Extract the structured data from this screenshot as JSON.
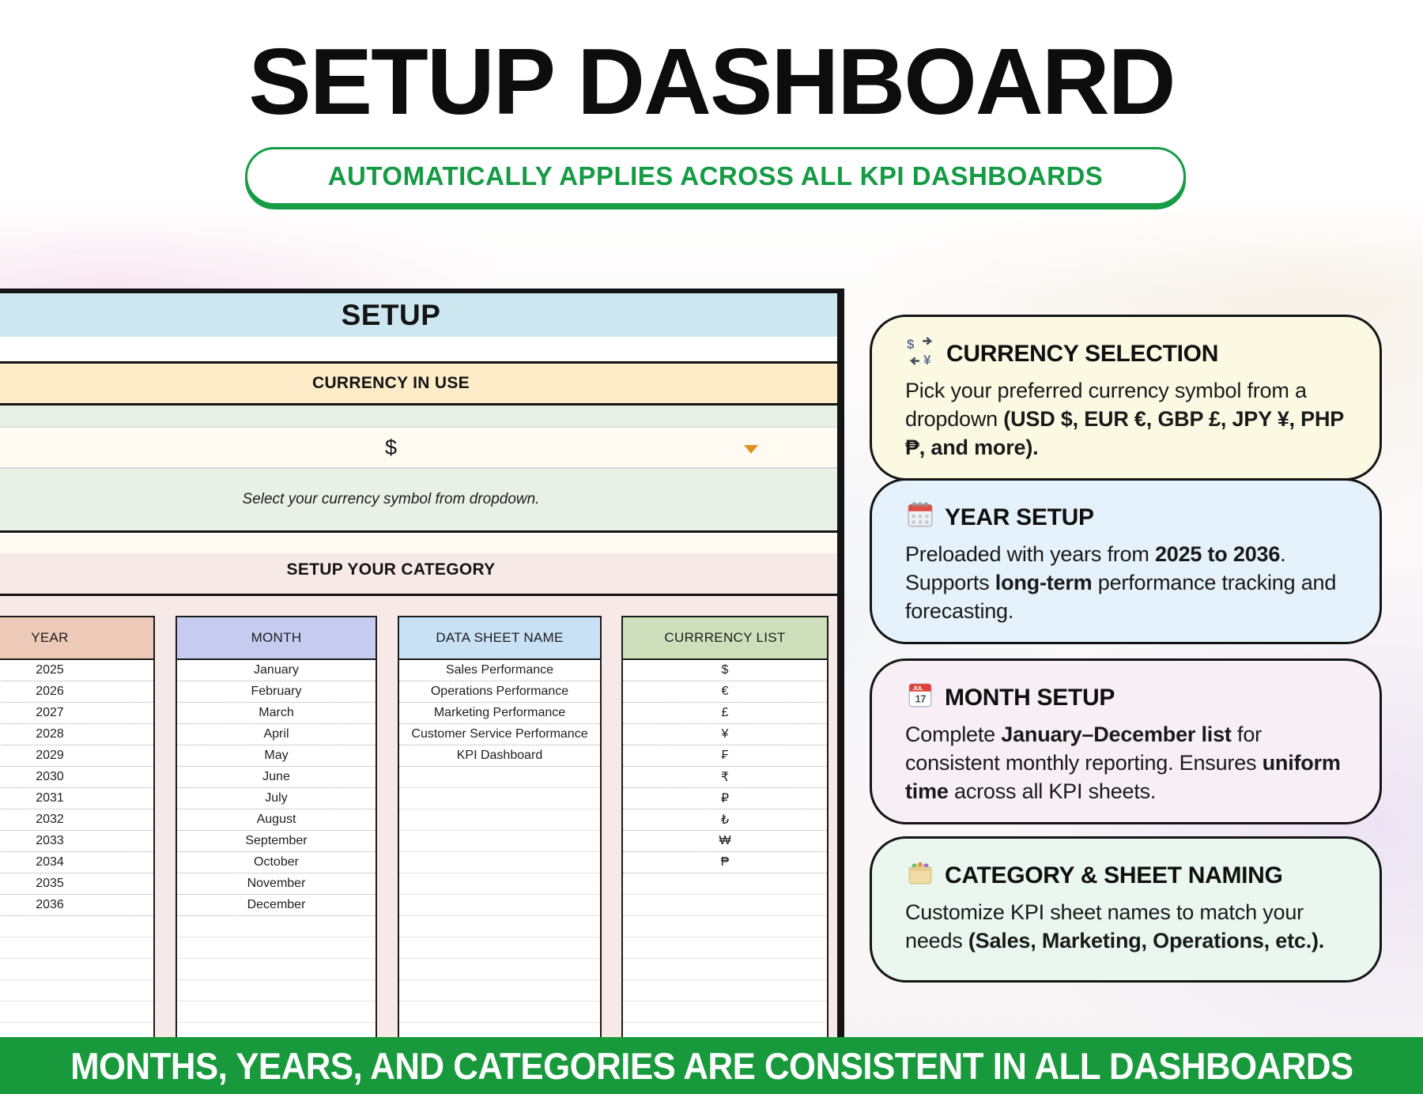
{
  "page": {
    "title": "SETUP DASHBOARD",
    "badge": "AUTOMATICALLY APPLIES ACROSS ALL KPI DASHBOARDS",
    "footer": "MONTHS, YEARS, AND CATEGORIES ARE CONSISTENT IN ALL DASHBOARDS"
  },
  "colors": {
    "accent_green": "#169c44",
    "banner_green": "#189a3c",
    "sheet_header_blue": "#cde7f0",
    "currency_band_yellow": "#fcedc8",
    "category_section_pink": "#f6e9e7",
    "dropdown_caret_orange": "#e0921f"
  },
  "sheet": {
    "title": "SETUP",
    "currency": {
      "header": "CURRENCY IN USE",
      "value": "$",
      "dropdown_icon": "chevron-down-icon",
      "helper": "Select your currency symbol from dropdown."
    },
    "category": {
      "header": "SETUP YOUR CATEGORY",
      "tables": [
        {
          "name": "year",
          "header": "YEAR",
          "header_color": "#edc9b8",
          "values": [
            "2025",
            "2026",
            "2027",
            "2028",
            "2029",
            "2030",
            "2031",
            "2032",
            "2033",
            "2034",
            "2035",
            "2036"
          ]
        },
        {
          "name": "month",
          "header": "MONTH",
          "header_color": "#c6ccf0",
          "values": [
            "January",
            "February",
            "March",
            "April",
            "May",
            "June",
            "July",
            "August",
            "September",
            "October",
            "November",
            "December"
          ]
        },
        {
          "name": "data-sheet-name",
          "header": "DATA SHEET NAME",
          "header_color": "#c9e1f5",
          "values": [
            "Sales Performance",
            "Operations Performance",
            "Marketing Performance",
            "Customer Service Performance",
            "KPI Dashboard"
          ]
        },
        {
          "name": "currency-list",
          "header": "CURRRENCY LIST",
          "header_color": "#cedfbc",
          "values": [
            "$",
            "€",
            "£",
            "¥",
            "₣",
            "₹",
            "₽",
            "₺",
            "₩",
            "₱"
          ]
        }
      ]
    }
  },
  "callouts": [
    {
      "icon": "currency-exchange-icon",
      "bg": "#fcf9e2",
      "title": "CURRENCY SELECTION",
      "body": [
        {
          "t": "Pick your preferred currency symbol from a dropdown "
        },
        {
          "t": "(USD $, EUR €, GBP £, JPY ¥, PHP ₱, and more).",
          "b": true
        }
      ]
    },
    {
      "icon": "spiral-calendar-icon",
      "bg": "#e5f2fb",
      "title": "YEAR SETUP",
      "body": [
        {
          "t": "Preloaded with years from "
        },
        {
          "t": "2025 to 2036",
          "b": true
        },
        {
          "t": ". Supports "
        },
        {
          "t": "long-term",
          "b": true
        },
        {
          "t": " performance tracking and forecasting."
        }
      ]
    },
    {
      "icon": "calendar-date-icon",
      "bg": "#f8eef6",
      "title": "MONTH SETUP",
      "body": [
        {
          "t": "Complete "
        },
        {
          "t": "January–December list",
          "b": true
        },
        {
          "t": " for consistent monthly reporting. Ensures "
        },
        {
          "t": "uniform time",
          "b": true
        },
        {
          "t": " across all KPI sheets."
        }
      ]
    },
    {
      "icon": "card-index-icon",
      "bg": "#e9f7ef",
      "title": "CATEGORY & SHEET NAMING",
      "body": [
        {
          "t": "Customize KPI sheet names to match your needs "
        },
        {
          "t": "(Sales, Marketing, Operations, etc.).",
          "b": true
        }
      ]
    }
  ]
}
